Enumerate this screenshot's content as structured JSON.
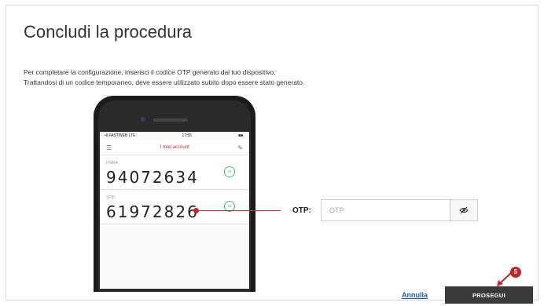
{
  "page": {
    "title": "Concludi la procedura",
    "description_line1": "Per completare la configurazione, inserisci il codice OTP generato dal tuo dispositivo.",
    "description_line2": "Trattandosi di un codice temporaneo, deve essere utilizzato subito dopo essere stato generato."
  },
  "phone": {
    "status_carrier": "•ll FASTWEB  LTE",
    "status_time": "17:55",
    "status_battery": "■■",
    "appbar_title": "I miei account",
    "menu_icon": "list-icon",
    "edit_icon": "pencil-icon",
    "accounts": [
      {
        "label": "FIRMA",
        "code": "94072634",
        "timer": "16"
      },
      {
        "label": "SPID",
        "code": "61972826",
        "timer": "16"
      }
    ]
  },
  "otp": {
    "label": "OTP:",
    "placeholder": "OTP",
    "toggle_icon": "eye-icon"
  },
  "actions": {
    "cancel_label": "Annulla",
    "proceed_label": "PROSEGUI",
    "step_badge": "5"
  },
  "colors": {
    "accent_red": "#c0272d",
    "link_blue": "#1a5ca8",
    "button_dark": "#3a3a3a",
    "timer_green": "#56b36b"
  }
}
